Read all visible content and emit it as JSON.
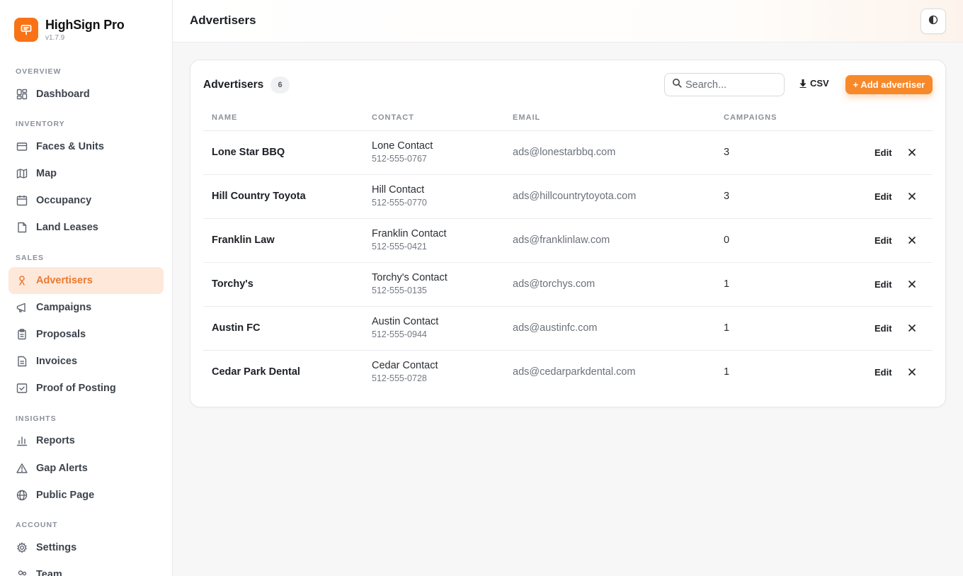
{
  "brand": {
    "name": "HighSign Pro",
    "version": "v1.7.9"
  },
  "sidebar": {
    "sections": [
      {
        "label": "OVERVIEW",
        "items": [
          {
            "label": "Dashboard",
            "icon": "dashboard-icon"
          }
        ]
      },
      {
        "label": "INVENTORY",
        "items": [
          {
            "label": "Faces & Units",
            "icon": "panel-icon"
          },
          {
            "label": "Map",
            "icon": "map-icon"
          },
          {
            "label": "Occupancy",
            "icon": "calendar-icon"
          },
          {
            "label": "Land Leases",
            "icon": "file-icon"
          }
        ]
      },
      {
        "label": "SALES",
        "items": [
          {
            "label": "Advertisers",
            "icon": "person-icon",
            "active": true
          },
          {
            "label": "Campaigns",
            "icon": "megaphone-icon"
          },
          {
            "label": "Proposals",
            "icon": "clipboard-icon"
          },
          {
            "label": "Invoices",
            "icon": "document-icon"
          },
          {
            "label": "Proof of Posting",
            "icon": "check-square-icon"
          }
        ]
      },
      {
        "label": "INSIGHTS",
        "items": [
          {
            "label": "Reports",
            "icon": "bar-chart-icon"
          },
          {
            "label": "Gap Alerts",
            "icon": "warning-icon"
          },
          {
            "label": "Public Page",
            "icon": "globe-icon"
          }
        ]
      },
      {
        "label": "ACCOUNT",
        "items": [
          {
            "label": "Settings",
            "icon": "gear-icon"
          },
          {
            "label": "Team",
            "icon": "team-icon"
          }
        ]
      }
    ]
  },
  "header": {
    "title": "Advertisers",
    "theme_toggle_icon": "half-circle-icon"
  },
  "card": {
    "title": "Advertisers",
    "count": "6",
    "search_placeholder": "Search...",
    "csv_label": "CSV",
    "add_label": "+ Add advertiser",
    "columns": [
      "NAME",
      "CONTACT",
      "EMAIL",
      "CAMPAIGNS"
    ],
    "edit_label": "Edit",
    "rows": [
      {
        "name": "Lone Star BBQ",
        "contact": "Lone Contact",
        "phone": "512-555-0767",
        "email": "ads@lonestarbbq.com",
        "campaigns": "3"
      },
      {
        "name": "Hill Country Toyota",
        "contact": "Hill Contact",
        "phone": "512-555-0770",
        "email": "ads@hillcountrytoyota.com",
        "campaigns": "3"
      },
      {
        "name": "Franklin Law",
        "contact": "Franklin Contact",
        "phone": "512-555-0421",
        "email": "ads@franklinlaw.com",
        "campaigns": "0"
      },
      {
        "name": "Torchy's",
        "contact": "Torchy's Contact",
        "phone": "512-555-0135",
        "email": "ads@torchys.com",
        "campaigns": "1"
      },
      {
        "name": "Austin FC",
        "contact": "Austin Contact",
        "phone": "512-555-0944",
        "email": "ads@austinfc.com",
        "campaigns": "1"
      },
      {
        "name": "Cedar Park Dental",
        "contact": "Cedar Contact",
        "phone": "512-555-0728",
        "email": "ads@cedarparkdental.com",
        "campaigns": "1"
      }
    ]
  },
  "colors": {
    "accent": "#f7892a",
    "active_bg": "#fde8da",
    "active_text": "#ea7a30"
  }
}
